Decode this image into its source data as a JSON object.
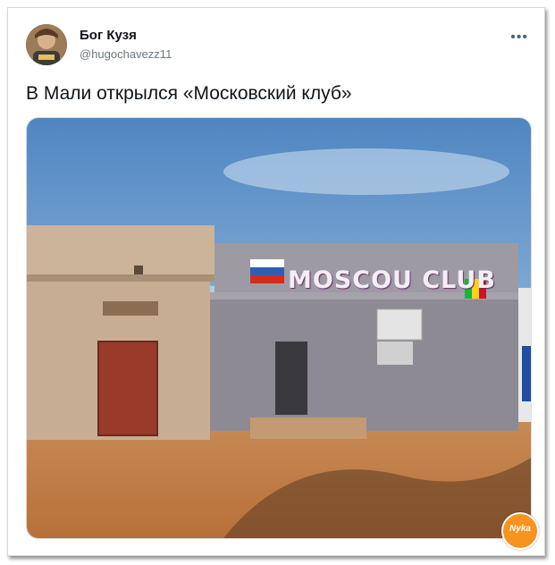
{
  "author": {
    "name": "Бог Кузя",
    "handle": "@hugochavezz11"
  },
  "more_label": "•••",
  "tweet": {
    "text": "В Мали открылся «Московский клуб»"
  },
  "media": {
    "sign_text": "MOSCOU CLUB"
  },
  "watermark": {
    "text": "Nyka"
  },
  "colors": {
    "sky": "#5b8fc8",
    "ground": "#c9834a",
    "wall": "#8e8a93",
    "door_red": "#9a3a2a"
  }
}
